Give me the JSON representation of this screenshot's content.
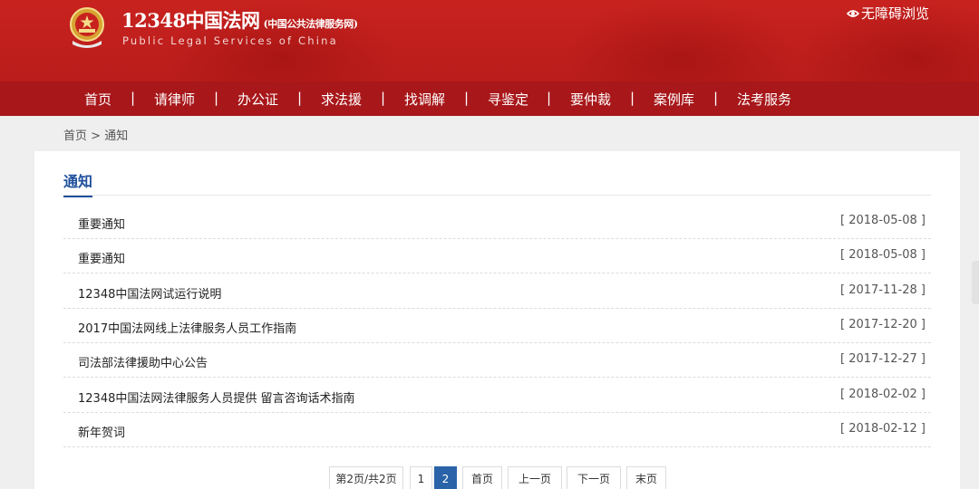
{
  "header": {
    "site_title": "12348中国法网",
    "site_subtitle": "(中国公共法律服务网)",
    "site_title_en": "Public Legal Services of China",
    "accessibility_label": "无障碍浏览",
    "colors": {
      "header_red": "#c8221f",
      "nav_red": "#a8171a",
      "accent_blue": "#1f4f9c"
    }
  },
  "nav": {
    "items": [
      "首页",
      "请律师",
      "办公证",
      "求法援",
      "找调解",
      "寻鉴定",
      "要仲裁",
      "案例库",
      "法考服务"
    ],
    "separator": "|"
  },
  "breadcrumb": {
    "home": "首页",
    "sep": ">",
    "current": "通知"
  },
  "panel": {
    "title": "通知",
    "items": [
      {
        "title": "重要通知",
        "date": "[ 2018-05-08 ]"
      },
      {
        "title": "重要通知",
        "date": "[ 2018-05-08 ]"
      },
      {
        "title": "12348中国法网试运行说明",
        "date": "[ 2017-11-28 ]"
      },
      {
        "title": "2017中国法网线上法律服务人员工作指南",
        "date": "[ 2017-12-20 ]"
      },
      {
        "title": "司法部法律援助中心公告",
        "date": "[ 2017-12-27 ]"
      },
      {
        "title": "12348中国法网法律服务人员提供 留言咨询话术指南",
        "date": "[ 2018-02-02 ]"
      },
      {
        "title": "新年贺词",
        "date": "[ 2018-02-12 ]"
      }
    ]
  },
  "pagination": {
    "info": "第2页/共2页",
    "pages": [
      "1",
      "2"
    ],
    "current_page": "2",
    "first": "首页",
    "prev": "上一页",
    "next": "下一页",
    "last": "末页"
  }
}
